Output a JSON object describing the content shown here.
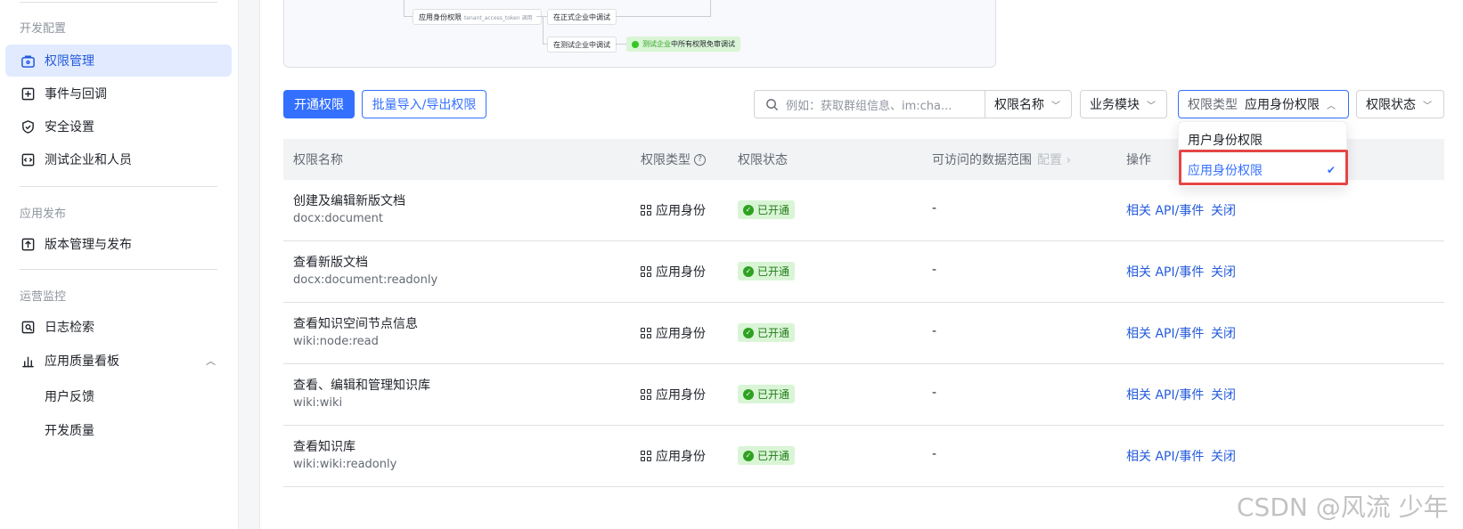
{
  "sidebar": {
    "section_dev": "开发配置",
    "items_dev": [
      {
        "label": "权限管理",
        "active": true
      },
      {
        "label": "事件与回调"
      },
      {
        "label": "安全设置"
      },
      {
        "label": "测试企业和人员"
      }
    ],
    "section_release": "应用发布",
    "items_release": [
      {
        "label": "版本管理与发布"
      }
    ],
    "section_ops": "运营监控",
    "items_ops": [
      {
        "label": "日志检索"
      },
      {
        "label": "应用质量看板"
      }
    ],
    "sub_items": [
      "用户反馈",
      "开发质量"
    ]
  },
  "diagram": {
    "node_app_auth": "应用身份权限",
    "node_token_hint": "tenant_access_token 调用",
    "node_prod": "在正式企业中调试",
    "node_test": "在测试企业中调试",
    "node_ok_prefix": "测试企业",
    "node_ok_rest": "中所有权限免审调试"
  },
  "toolbar": {
    "open_button": "开通权限",
    "import_export_button": "批量导入/导出权限",
    "search_placeholder": "例如：获取群组信息、im:cha...",
    "filter_name": "权限名称",
    "filter_module": "业务模块",
    "filter_type_label": "权限类型",
    "filter_type_value": "应用身份权限",
    "filter_status": "权限状态"
  },
  "dropdown": {
    "options": [
      "用户身份权限",
      "应用身份权限"
    ],
    "selected_index": 1
  },
  "table": {
    "headers": {
      "name": "权限名称",
      "type": "权限类型",
      "status": "权限状态",
      "scope": "可访问的数据范围",
      "scope_config": "配置",
      "actions": "操作"
    },
    "rows": [
      {
        "title": "创建及编辑新版文档",
        "code": "docx:document",
        "type": "应用身份",
        "status": "已开通",
        "scope": "-",
        "action1": "相关 API/事件",
        "action2": "关闭"
      },
      {
        "title": "查看新版文档",
        "code": "docx:document:readonly",
        "type": "应用身份",
        "status": "已开通",
        "scope": "-",
        "action1": "相关 API/事件",
        "action2": "关闭"
      },
      {
        "title": "查看知识空间节点信息",
        "code": "wiki:node:read",
        "type": "应用身份",
        "status": "已开通",
        "scope": "-",
        "action1": "相关 API/事件",
        "action2": "关闭"
      },
      {
        "title": "查看、编辑和管理知识库",
        "code": "wiki:wiki",
        "type": "应用身份",
        "status": "已开通",
        "scope": "-",
        "action1": "相关 API/事件",
        "action2": "关闭"
      },
      {
        "title": "查看知识库",
        "code": "wiki:wiki:readonly",
        "type": "应用身份",
        "status": "已开通",
        "scope": "-",
        "action1": "相关 API/事件",
        "action2": "关闭"
      }
    ]
  },
  "watermark": "CSDN @风流 少年",
  "colors": {
    "accent": "#3370ff",
    "active_bg": "#e1eaff",
    "success_bg": "#d9f5d6",
    "highlight": "#e54545"
  }
}
